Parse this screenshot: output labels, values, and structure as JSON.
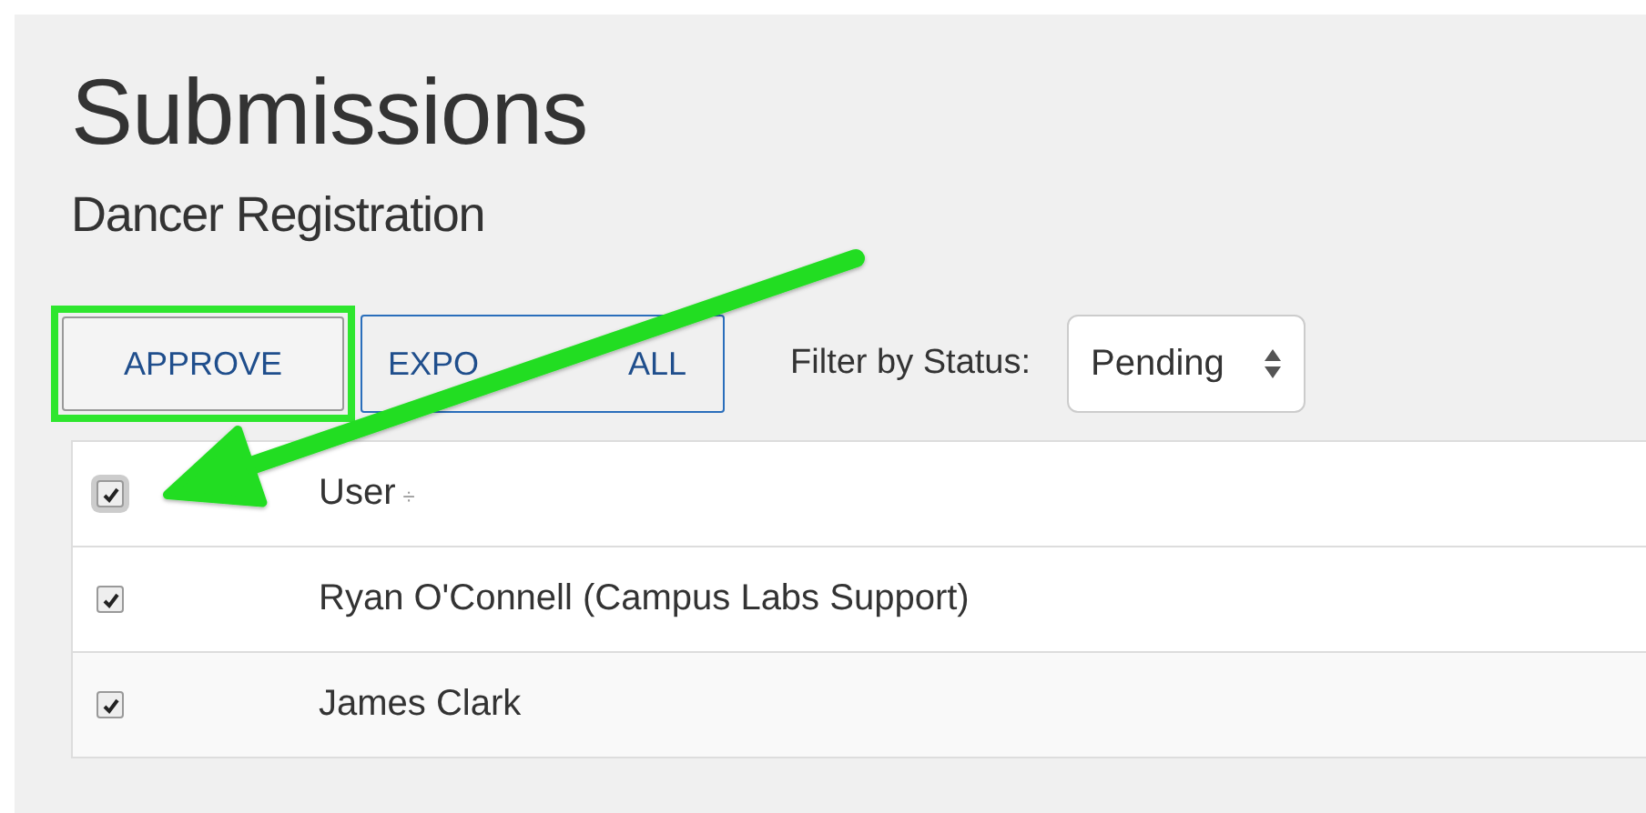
{
  "page": {
    "title": "Submissions",
    "subtitle": "Dancer Registration"
  },
  "toolbar": {
    "buttons": [
      {
        "label": "APPROVE",
        "highlighted": true
      },
      {
        "label_parts": [
          "EXPO",
          "ALL"
        ],
        "highlighted": false
      }
    ],
    "filter": {
      "label": "Filter by Status:",
      "value": "Pending"
    }
  },
  "table": {
    "select_all": {
      "checked": true
    },
    "columns": [
      {
        "label": "User",
        "sort_icon": "÷"
      }
    ],
    "rows": [
      {
        "user": "Ryan O'Connell (Campus Labs Support)",
        "checked": true
      },
      {
        "user": "James Clark",
        "checked": true
      }
    ]
  }
}
